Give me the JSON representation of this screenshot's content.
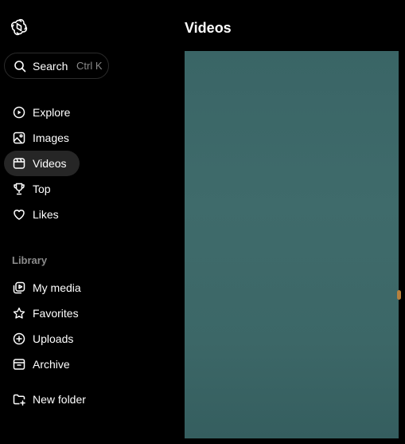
{
  "search": {
    "label": "Search",
    "shortcut": "Ctrl K"
  },
  "nav": {
    "explore": "Explore",
    "images": "Images",
    "videos": "Videos",
    "top": "Top",
    "likes": "Likes"
  },
  "library": {
    "heading": "Library",
    "my_media": "My media",
    "favorites": "Favorites",
    "uploads": "Uploads",
    "archive": "Archive",
    "new_folder": "New folder"
  },
  "main": {
    "title": "Videos"
  },
  "colors": {
    "background": "#000000",
    "active_item": "#262626",
    "video_thumbnail": "#3f6b6b"
  }
}
